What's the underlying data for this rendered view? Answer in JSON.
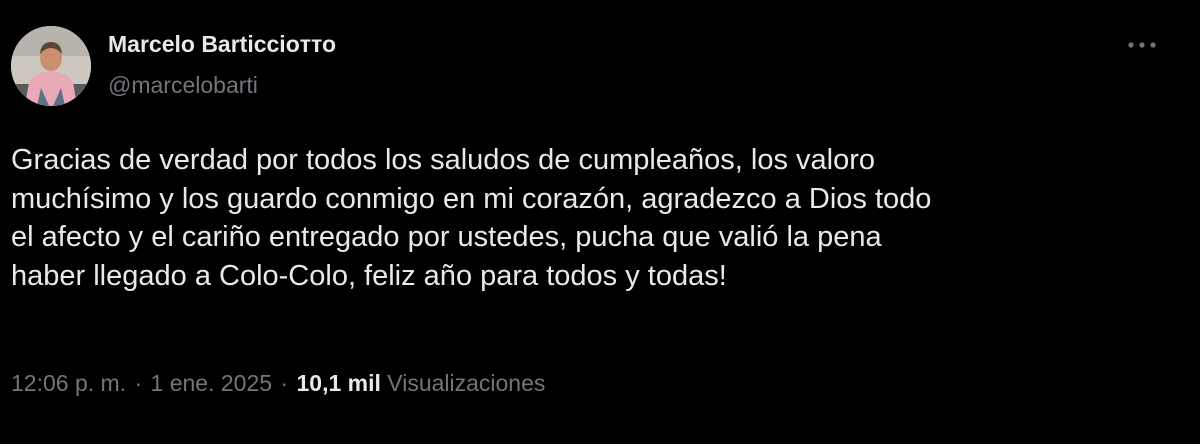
{
  "author": {
    "display_name": "Marcelo Barticcioтто",
    "handle": "@marcelobarti"
  },
  "tweet": {
    "text_lines": [
      "Gracias de verdad por todos los saludos de cumpleaños, los valoro",
      "muchísimo y los guardo conmigo en mi corazón, agradezco a Dios todo",
      "el afecto y el cariño entregado por ustedes, pucha que valió la pena",
      "haber llegado a Colo-Colo, feliz año para todos y todas!"
    ]
  },
  "meta": {
    "time": "12:06 p. m.",
    "separator": "·",
    "date": "1 ene. 2025",
    "views_count": "10,1 mil",
    "views_label": "Visualizaciones"
  },
  "icons": {
    "more": "more-horizontal-icon",
    "avatar": "avatar"
  },
  "colors": {
    "background": "#000000",
    "primary_text": "#e7e9ea",
    "secondary_text": "#71767b"
  }
}
